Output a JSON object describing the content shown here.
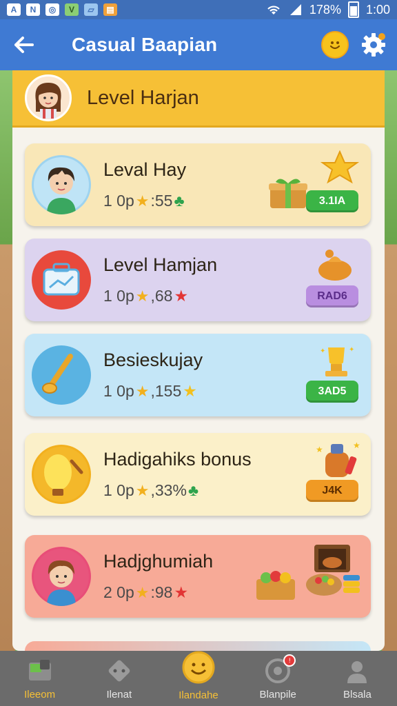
{
  "status_bar": {
    "icons": [
      "a-icon",
      "n-icon",
      "circle-icon",
      "v-icon",
      "photo-icon",
      "orange-app-icon"
    ],
    "battery": "178%",
    "time": "1:00"
  },
  "app_bar": {
    "title": "Casual Baapian"
  },
  "panel_header": {
    "title": "Level Harjan"
  },
  "cards": [
    {
      "title": "Leval Hay",
      "sub_prefix": "1 0p",
      "sub_value": ":55",
      "trail_symbol": "♣",
      "badge": "3.1IA",
      "bg": "#f9e7b7",
      "badge_color": "#3bb446",
      "trail_color": "#2ea34d"
    },
    {
      "title": "Level Hamjan",
      "sub_prefix": "1 0p",
      "sub_value": ",68",
      "trail_symbol": "★",
      "badge": "RAD6",
      "bg": "#dcd3ef",
      "badge_color": "#b98ee0",
      "trail_color": "#e23535"
    },
    {
      "title": "Besieskujay",
      "sub_prefix": "1 0p",
      "sub_value": ",155",
      "trail_symbol": "★",
      "badge": "3AD5",
      "bg": "#c4e6f7",
      "badge_color": "#3bb446",
      "trail_color": "#f2c01e"
    },
    {
      "title": "Hadigahiks bonus",
      "sub_prefix": "1 0p",
      "sub_value": ",33%",
      "trail_symbol": "♣",
      "badge": "J4K",
      "bg": "#fbf0c9",
      "badge_color": "#f09a24",
      "trail_color": "#2ea34d"
    },
    {
      "title": "Hadjghumiah",
      "sub_prefix": "2 0p",
      "sub_value": ":98",
      "trail_symbol": "★",
      "badge": "",
      "bg": "#f7aa97",
      "badge_color": "",
      "trail_color": "#e23535"
    }
  ],
  "bottom_nav": [
    {
      "label": "Ileeom",
      "icon": "cards-icon",
      "active": true
    },
    {
      "label": "Ilenat",
      "icon": "dice-icon",
      "active": false
    },
    {
      "label": "Ilandahe",
      "icon": "smiley-coin-icon",
      "active": true
    },
    {
      "label": "Blanpile",
      "icon": "target-icon",
      "active": false
    },
    {
      "label": "Blsala",
      "icon": "person-icon",
      "active": false
    }
  ]
}
